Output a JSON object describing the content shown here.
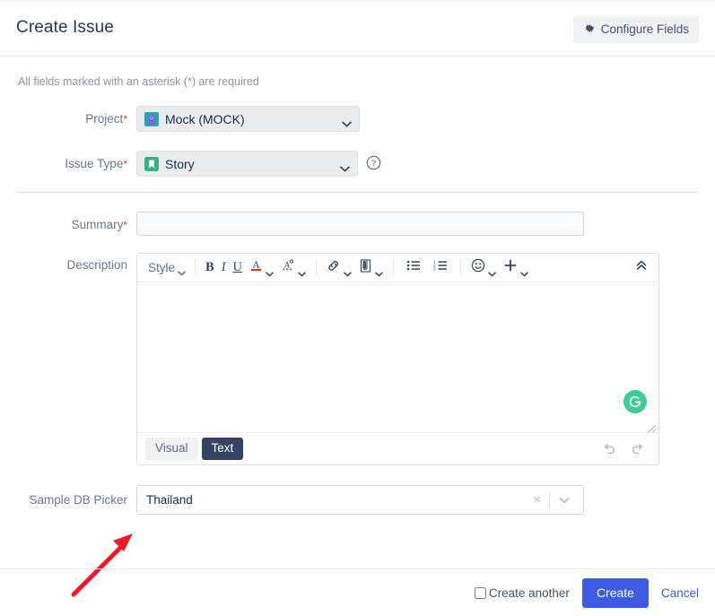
{
  "header": {
    "title": "Create Issue",
    "configure_fields_label": "Configure Fields",
    "gear_icon": "gear-icon"
  },
  "required_note": "All fields marked with an asterisk (*) are required",
  "fields": {
    "project": {
      "label": "Project",
      "required_marker": "*",
      "value": "Mock (MOCK)",
      "icon": "project-avatar-icon"
    },
    "issue_type": {
      "label": "Issue Type",
      "required_marker": "*",
      "value": "Story",
      "icon": "story-bookmark-icon",
      "help_icon": "question-circle-icon"
    },
    "summary": {
      "label": "Summary",
      "required_marker": "*",
      "value": "",
      "placeholder": ""
    },
    "description": {
      "label": "Description",
      "value": "",
      "placeholder": ""
    },
    "sample_db_picker": {
      "label": "Sample DB Picker",
      "value": "Thailand",
      "clear_glyph": "×",
      "clear_icon": "clear-icon",
      "chevron_icon": "chevron-down-icon"
    }
  },
  "editor": {
    "toolbar": {
      "style_label": "Style",
      "bold_label": "B",
      "italic_label": "I",
      "underline_label": "U",
      "text_color_label": "A",
      "items": [
        {
          "name": "style-dropdown",
          "icon": "style-text"
        },
        {
          "name": "bold-button",
          "icon": "bold-icon"
        },
        {
          "name": "italic-button",
          "icon": "italic-icon"
        },
        {
          "name": "underline-button",
          "icon": "underline-icon"
        },
        {
          "name": "text-color-button",
          "icon": "text-color-icon"
        },
        {
          "name": "text-effects-button",
          "icon": "text-effects-icon"
        },
        {
          "name": "link-button",
          "icon": "link-icon"
        },
        {
          "name": "attachment-button",
          "icon": "attachment-icon"
        },
        {
          "name": "bullet-list-button",
          "icon": "bullet-list-icon"
        },
        {
          "name": "numbered-list-button",
          "icon": "numbered-list-icon"
        },
        {
          "name": "emoji-button",
          "icon": "emoji-icon"
        },
        {
          "name": "insert-more-button",
          "icon": "plus-icon"
        },
        {
          "name": "collapse-toolbar-button",
          "icon": "double-chevron-up-icon"
        }
      ]
    },
    "grammarly_icon": "grammarly-icon",
    "grammarly_letter": "G",
    "modes": {
      "visual_label": "Visual",
      "text_label": "Text",
      "active": "Text"
    },
    "undo_icon": "undo-icon",
    "redo_icon": "redo-icon"
  },
  "footer": {
    "create_another_label": "Create another",
    "create_another_checked": false,
    "create_label": "Create",
    "cancel_label": "Cancel"
  },
  "annotation": {
    "type": "red-arrow",
    "color": "#ed1c24"
  },
  "colors": {
    "accent_blue": "#3d5ce3",
    "link_blue": "#3b5ce3",
    "title": "#253858",
    "label": "#6b778c",
    "required_asterisk": "#d04437",
    "select_bg": "#ebecf0",
    "story_green": "#36b37e",
    "grammarly_green": "#3ecb97",
    "text_dark": "#344563"
  }
}
